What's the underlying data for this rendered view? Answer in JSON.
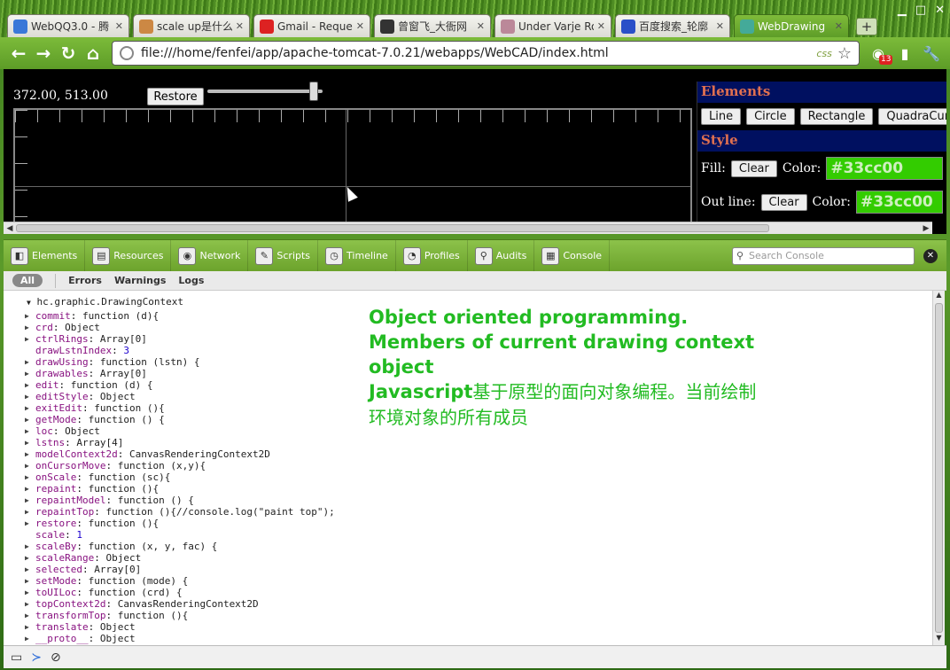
{
  "tabs": [
    {
      "label": "WebQQ3.0 - 腾",
      "icon": "ie-icon",
      "color": "#3a78d8"
    },
    {
      "label": "scale up是什么",
      "icon": "scale-icon",
      "color": "#c84"
    },
    {
      "label": "Gmail - Reques",
      "icon": "gmail-icon",
      "color": "#d22"
    },
    {
      "label": "曾窗飞_大衙网",
      "icon": "qq-icon",
      "color": "#333"
    },
    {
      "label": "Under Varje Ro",
      "icon": "page-icon",
      "color": "#b89"
    },
    {
      "label": "百度搜索_轮廓",
      "icon": "baidu-icon",
      "color": "#2a50c8"
    },
    {
      "label": "WebDrawing",
      "icon": "chrome-icon",
      "color": "#4a9"
    }
  ],
  "address": {
    "url": "file:///home/fenfei/app/apache-tomcat-7.0.21/webapps/WebCAD/index.html",
    "ext_label": "css"
  },
  "extensions": {
    "badge": "13"
  },
  "webcad": {
    "coords": "372.00, 513.00",
    "restore_label": "Restore",
    "elements_title": "Elements",
    "element_buttons": [
      "Line",
      "Circle",
      "Rectangle",
      "QuadraCurv"
    ],
    "style_title": "Style",
    "fill_label": "Fill:",
    "outline_label": "Out line:",
    "clear_label": "Clear",
    "color_label": "Color:",
    "fill_color": "#33cc00",
    "outline_color": "#33cc00"
  },
  "devtools": {
    "tools": [
      {
        "label": "Elements",
        "icon": "elements-icon"
      },
      {
        "label": "Resources",
        "icon": "resources-icon"
      },
      {
        "label": "Network",
        "icon": "network-icon"
      },
      {
        "label": "Scripts",
        "icon": "scripts-icon"
      },
      {
        "label": "Timeline",
        "icon": "timeline-icon"
      },
      {
        "label": "Profiles",
        "icon": "profiles-icon"
      },
      {
        "label": "Audits",
        "icon": "audits-icon"
      },
      {
        "label": "Console",
        "icon": "console-icon"
      }
    ],
    "search_placeholder": "Search Console",
    "filters": [
      "All",
      "Errors",
      "Warnings",
      "Logs"
    ]
  },
  "console": {
    "root": "hc.graphic.DrawingContext",
    "props": [
      {
        "key": "commit",
        "val": "function (d){",
        "expand": true
      },
      {
        "key": "crd",
        "val": "Object",
        "expand": true
      },
      {
        "key": "ctrlRings",
        "val": "Array[0]",
        "expand": true
      },
      {
        "key": "drawLstnIndex",
        "val": "3",
        "expand": false,
        "num": true
      },
      {
        "key": "drawUsing",
        "val": "function (lstn) {",
        "expand": true
      },
      {
        "key": "drawables",
        "val": "Array[0]",
        "expand": true
      },
      {
        "key": "edit",
        "val": "function (d) {",
        "expand": true
      },
      {
        "key": "editStyle",
        "val": "Object",
        "expand": true
      },
      {
        "key": "exitEdit",
        "val": "function (){",
        "expand": true
      },
      {
        "key": "getMode",
        "val": "function () {",
        "expand": true
      },
      {
        "key": "loc",
        "val": "Object",
        "expand": true
      },
      {
        "key": "lstns",
        "val": "Array[4]",
        "expand": true
      },
      {
        "key": "modelContext2d",
        "val": "CanvasRenderingContext2D",
        "expand": true
      },
      {
        "key": "onCursorMove",
        "val": "function (x,y){",
        "expand": true
      },
      {
        "key": "onScale",
        "val": "function (sc){",
        "expand": true
      },
      {
        "key": "repaint",
        "val": "function (){",
        "expand": true
      },
      {
        "key": "repaintModel",
        "val": "function () {",
        "expand": true
      },
      {
        "key": "repaintTop",
        "val": "function (){//console.log(\"paint top\");",
        "expand": true
      },
      {
        "key": "restore",
        "val": "function (){",
        "expand": true
      },
      {
        "key": "scale",
        "val": "1",
        "expand": false,
        "num": true
      },
      {
        "key": "scaleBy",
        "val": "function (x, y, fac) {",
        "expand": true
      },
      {
        "key": "scaleRange",
        "val": "Object",
        "expand": true
      },
      {
        "key": "selected",
        "val": "Array[0]",
        "expand": true
      },
      {
        "key": "setMode",
        "val": "function (mode) {",
        "expand": true
      },
      {
        "key": "toUILoc",
        "val": "function (crd) {",
        "expand": true
      },
      {
        "key": "topContext2d",
        "val": "CanvasRenderingContext2D",
        "expand": true
      },
      {
        "key": "transformTop",
        "val": "function (){",
        "expand": true
      },
      {
        "key": "translate",
        "val": "Object",
        "expand": true
      },
      {
        "key": "__proto__",
        "val": "Object",
        "expand": true
      }
    ],
    "note_en": "Object oriented programming. Members of current drawing context object",
    "note_zh_prefix": "Javascript",
    "note_zh": "基于原型的面向对象编程。当前绘制环境对象的所有成员"
  }
}
